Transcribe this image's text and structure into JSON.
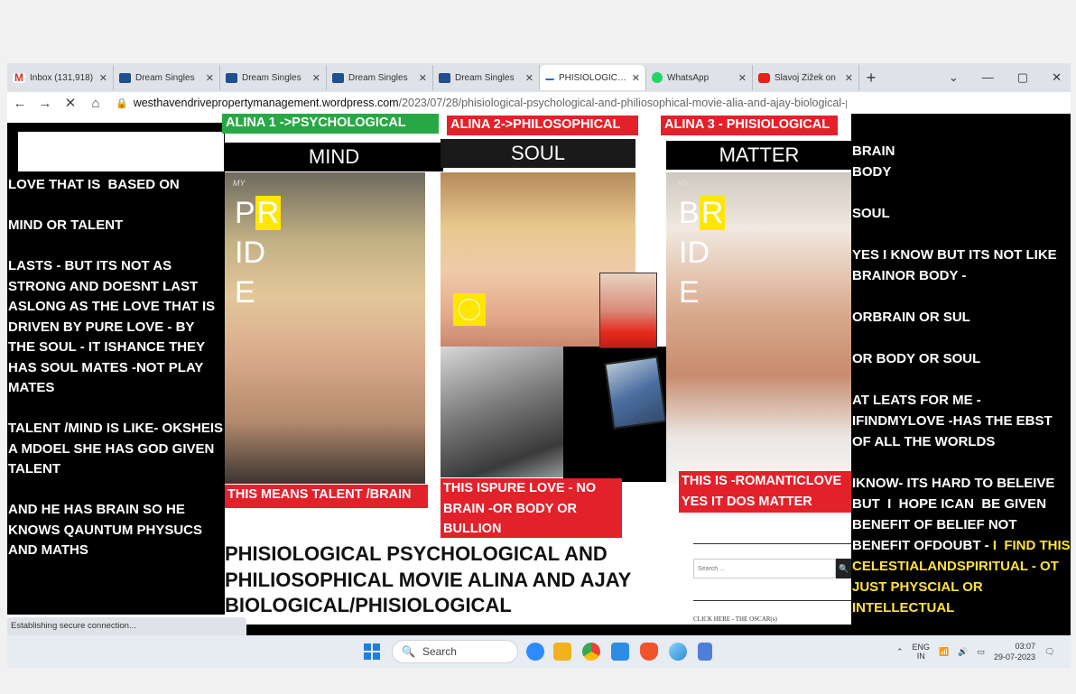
{
  "tabs": [
    {
      "label": "Inbox (131,918)",
      "icon": "gmail-icon"
    },
    {
      "label": "Dream Singles",
      "icon": "dreamsingles-icon"
    },
    {
      "label": "Dream Singles",
      "icon": "dreamsingles-icon"
    },
    {
      "label": "Dream Singles",
      "icon": "dreamsingles-icon"
    },
    {
      "label": "Dream Singles",
      "icon": "dreamsingles-icon"
    },
    {
      "label": "PHISIOLOGICAL",
      "icon": "wordpress-icon",
      "active": true
    },
    {
      "label": "WhatsApp",
      "icon": "whatsapp-icon"
    },
    {
      "label": "Slavoj Žižek on",
      "icon": "youtube-icon"
    }
  ],
  "address": {
    "domain": "westhavendrivepropertymanagement.wordpress.com",
    "path": "/2023/07/28/phisiological-psychological-and-philiosophical-movie-alia-and-ajay-biological-p"
  },
  "labels": {
    "alina1": "ALINA 1 ->PSYCHOLOGICAL",
    "alina2": "ALINA  2->PHILOSOPHICAL",
    "alina3": "ALINA 3 - PHISIOLOGICAL"
  },
  "headers": {
    "mind": "MIND",
    "soul": "SOUL",
    "matter": "MATTER"
  },
  "pride": {
    "left": {
      "l1a": "P",
      "l1b": "R",
      "l2": "ID",
      "l3": "E",
      "my": "MY"
    },
    "right": {
      "l1a": "B",
      "l1b": "R",
      "l2": "ID",
      "l3": "E",
      "my": "MY"
    }
  },
  "left_text": "LOVE THAT IS  BASED ON\n\nMIND OR TALENT\n\nLASTS - BUT ITS NOT AS STRONG AND DOESNT LAST ASLONG AS THE LOVE THAT IS DRIVEN BY PURE LOVE - BY THE SOUL - IT ISHANCE THEY HAS SOUL MATES -NOT PLAY MATES\n\nTALENT /MIND IS LIKE- OKSHEIS A MDOEL SHE HAS GOD GIVEN TALENT\n\nAND HE HAS BRAIN SO HE KNOWS QAUNTUM PHYSUCS AND MATHS",
  "right_text": {
    "white": "YES\n\nBRAIN\nBODY\n\nSOUL\n\nYES I KNOW BUT ITS NOT LIKE BRAINOR BODY -\n\nORBRAIN OR SUL\n\nOR BODY OR SOUL\n\nAT LEATS FOR ME - IFINDMYLOVE -HAS THE EBST OF ALL THE WORLDS\n\nIKNOW- ITS HARD TO BELEIVE  BUT  I  HOPE ICAN  BE GIVEN BENEFIT OF BELIEF NOT BENEFIT OFDOUBT - ",
    "yellow": "I  FIND THIS CELESTIALANDSPIRITUAL - OT JUST PHYSCIAL OR INTELLECTUAL"
  },
  "captions": {
    "cap1": "THIS MEANS TALENT /BRAIN",
    "cap2": "THIS ISPURE LOVE - NO BRAIN -OR BODY OR BULLION",
    "cap3": "THIS IS -ROMANTICLOVE YES IT DOS MATTER"
  },
  "title": "PHISIOLOGICAL PSYCHOLOGICAL AND PHILIOSOPHICAL MOVIE ALINA AND AJAY BIOLOGICAL/PHISIOLOGICAL",
  "sidebar": {
    "search_placeholder": "Search ...",
    "link": "CLICK HERE - THE OSCAR(s)"
  },
  "status": "Establishing secure connection...",
  "taskbar": {
    "search": "Search",
    "lang1": "ENG",
    "lang2": "IN",
    "time": "03:07",
    "date": "29-07-2023"
  },
  "colors": {
    "green_label": "#27a844",
    "red_label": "#e3212b",
    "highlight_yellow": "#ffe600"
  }
}
